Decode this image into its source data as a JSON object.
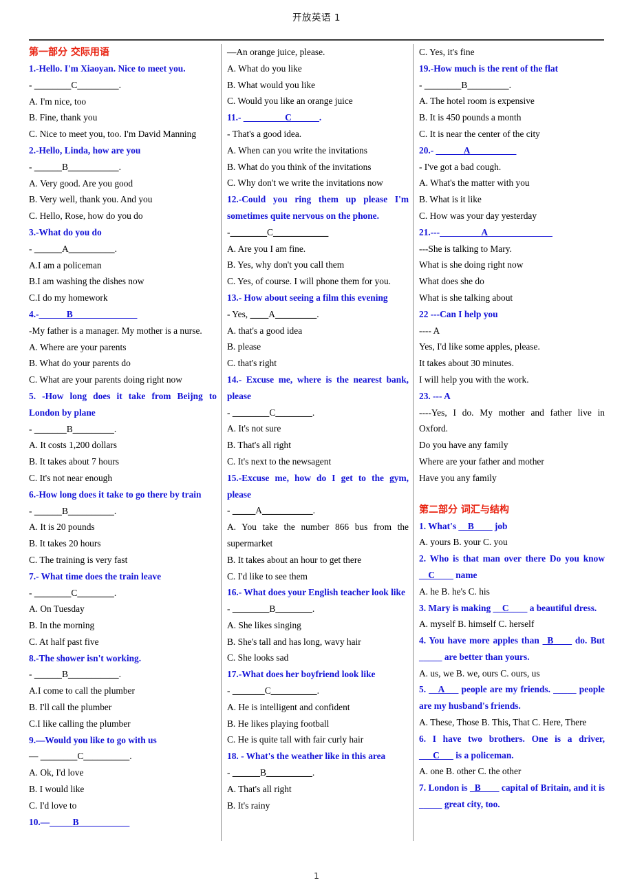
{
  "document": {
    "running_head": "开放英语 1",
    "page_number": "1"
  },
  "sections": {
    "part1_title": "第一部分  交际用语",
    "part2_title": "第二部分  词汇与结构"
  },
  "col1": [
    {
      "kind": "section",
      "text": "第一部分  交际用语"
    },
    {
      "kind": "q",
      "text": "1.-Hello. I'm Xiaoyan. Nice to meet you."
    },
    {
      "kind": "ansline",
      "prefix": "- ",
      "blank_left": "________",
      "answer": "C",
      "blank_right": "_________",
      "suffix": "."
    },
    {
      "kind": "opt",
      "text": "A. I'm nice, too"
    },
    {
      "kind": "opt",
      "text": "B. Fine, thank you"
    },
    {
      "kind": "opt",
      "text": "C. Nice to meet you, too. I'm David Manning"
    },
    {
      "kind": "q",
      "text": "2.-Hello, Linda, how are you"
    },
    {
      "kind": "ansline",
      "prefix": "- ",
      "blank_left": "______",
      "answer": "B",
      "blank_right": "___________",
      "suffix": "."
    },
    {
      "kind": "opt",
      "text": "A. Very good. Are you good"
    },
    {
      "kind": "opt",
      "text": "B. Very well, thank you. And you"
    },
    {
      "kind": "opt",
      "text": "C. Hello, Rose, how do you do"
    },
    {
      "kind": "q",
      "text": "3.-What do you do"
    },
    {
      "kind": "ansline",
      "prefix": "- ",
      "blank_left": "______",
      "answer": "A",
      "blank_right": "__________",
      "suffix": "."
    },
    {
      "kind": "opt",
      "text": "A.I am a policeman"
    },
    {
      "kind": "opt",
      "text": "B.I am washing the dishes now"
    },
    {
      "kind": "opt",
      "text": "C.I do my homework"
    },
    {
      "kind": "qblank",
      "prefix": "4.-",
      "blank_left": "______",
      "answer": "B",
      "blank_right": "______________"
    },
    {
      "kind": "opt",
      "text": "-My father is a manager. My mother is a nurse."
    },
    {
      "kind": "opt",
      "text": "A. Where are your parents"
    },
    {
      "kind": "opt",
      "text": "B. What do your parents do"
    },
    {
      "kind": "opt",
      "text": "C. What are your parents doing right now"
    },
    {
      "kind": "qjust",
      "text": "5. -How long does it take from Beijng to London by plane"
    },
    {
      "kind": "ansline",
      "prefix": "- ",
      "blank_left": "_______",
      "answer": "B",
      "blank_right": "_________",
      "suffix": "."
    },
    {
      "kind": "opt",
      "text": "A. It costs 1,200 dollars"
    },
    {
      "kind": "opt",
      "text": "B. It takes about 7 hours"
    },
    {
      "kind": "opt",
      "text": "C. It's not near enough"
    },
    {
      "kind": "q",
      "text": "6.-How long does it take to go there by train"
    },
    {
      "kind": "ansline",
      "prefix": "- ",
      "blank_left": "______",
      "answer": "B",
      "blank_right": "__________",
      "suffix": "."
    },
    {
      "kind": "opt",
      "text": "A. It is 20 pounds"
    },
    {
      "kind": "opt",
      "text": "B. It takes 20 hours"
    },
    {
      "kind": "opt",
      "text": "C. The training is very fast"
    },
    {
      "kind": "q",
      "text": "7.- What time does the train leave"
    },
    {
      "kind": "ansline",
      "prefix": "- ",
      "blank_left": "________",
      "answer": "C",
      "blank_right": "________",
      "suffix": "."
    },
    {
      "kind": "opt",
      "text": "A. On Tuesday"
    },
    {
      "kind": "opt",
      "text": "B. In the morning"
    },
    {
      "kind": "opt",
      "text": "C. At half past five"
    },
    {
      "kind": "q",
      "text": "8.-The shower isn't working."
    },
    {
      "kind": "ansline",
      "prefix": "- ",
      "blank_left": "______",
      "answer": "B",
      "blank_right": "___________",
      "suffix": "."
    },
    {
      "kind": "opt",
      "text": "A.I come to call the plumber"
    },
    {
      "kind": "opt",
      "text": "B. I'll call the plumber"
    },
    {
      "kind": "opt",
      "text": "C.I like calling the plumber"
    },
    {
      "kind": "q",
      "text": "9.—Would you like to go with us"
    },
    {
      "kind": "ansline",
      "prefix": "— ",
      "blank_left": "________",
      "answer": "C",
      "blank_right": "__________",
      "suffix": "."
    },
    {
      "kind": "opt",
      "text": "A. Ok, I'd love"
    },
    {
      "kind": "opt",
      "text": "B. I would like"
    },
    {
      "kind": "opt",
      "text": "C. I'd love to"
    },
    {
      "kind": "qblank",
      "prefix": "10.—",
      "blank_left": "_____",
      "answer": "B",
      "blank_right": "___________"
    }
  ],
  "col2": [
    {
      "kind": "opt",
      "text": "—An orange juice, please."
    },
    {
      "kind": "opt",
      "text": "A. What do you like"
    },
    {
      "kind": "opt",
      "text": "B. What would you like"
    },
    {
      "kind": "opt",
      "text": "C. Would you like an orange juice"
    },
    {
      "kind": "qblank",
      "prefix": "11.- ",
      "blank_left": "_________",
      "answer": "C",
      "blank_right": "______",
      "suffix": "."
    },
    {
      "kind": "opt",
      "text": "- That's a good idea."
    },
    {
      "kind": "opt",
      "text": "A. When can you write the invitations"
    },
    {
      "kind": "opt",
      "text": "B. What do you think of the invitations"
    },
    {
      "kind": "opt",
      "text": "C. Why don't we write the invitations now"
    },
    {
      "kind": "qjust",
      "text": "12.-Could you ring them up please I'm sometimes quite nervous on the phone."
    },
    {
      "kind": "ansline",
      "prefix": "-",
      "blank_left": "________",
      "answer": "C",
      "blank_right": "____________",
      "suffix": ""
    },
    {
      "kind": "opt",
      "text": "A. Are you I am fine."
    },
    {
      "kind": "opt",
      "text": "B. Yes, why don't you call them"
    },
    {
      "kind": "opt",
      "text": "C. Yes, of course. I will phone them for you."
    },
    {
      "kind": "q",
      "text": "13.- How about seeing a film this evening"
    },
    {
      "kind": "ansline",
      "prefix": "- Yes, ",
      "blank_left": "____",
      "answer": "A",
      "blank_right": "_________",
      "suffix": "."
    },
    {
      "kind": "opt",
      "text": "A. that's a good idea"
    },
    {
      "kind": "opt",
      "text": "B. please"
    },
    {
      "kind": "opt",
      "text": "C. that's right"
    },
    {
      "kind": "qjust",
      "text": "14.- Excuse me, where is the nearest bank, please"
    },
    {
      "kind": "ansline",
      "prefix": "- ",
      "blank_left": "________",
      "answer": "C",
      "blank_right": "________",
      "suffix": "."
    },
    {
      "kind": "opt",
      "text": "A. It's not sure"
    },
    {
      "kind": "opt",
      "text": "B. That's all right"
    },
    {
      "kind": "opt",
      "text": "C. It's next to the newsagent"
    },
    {
      "kind": "qjust",
      "text": "15.-Excuse me, how do I get to the gym, please"
    },
    {
      "kind": "ansline",
      "prefix": "- ",
      "blank_left": "_____",
      "answer": "A",
      "blank_right": "___________",
      "suffix": "."
    },
    {
      "kind": "optjust",
      "text": "A. You take the number 866 bus from the supermarket"
    },
    {
      "kind": "opt",
      "text": "B. It takes about an hour to get there"
    },
    {
      "kind": "opt",
      "text": "C. I'd like to see them"
    },
    {
      "kind": "qjust",
      "text": "16.- What does your English teacher look like"
    },
    {
      "kind": "ansline",
      "prefix": "- ",
      "blank_left": "________",
      "answer": "B",
      "blank_right": "________",
      "suffix": "."
    },
    {
      "kind": "opt",
      "text": "A. She likes singing"
    },
    {
      "kind": "opt",
      "text": "B. She's tall and has long, wavy hair"
    },
    {
      "kind": "opt",
      "text": "C. She looks sad"
    },
    {
      "kind": "q",
      "text": "17.-What does her boyfriend look like"
    },
    {
      "kind": "ansline",
      "prefix": "- ",
      "blank_left": "_______",
      "answer": "C",
      "blank_right": "__________",
      "suffix": "."
    },
    {
      "kind": "opt",
      "text": "A. He is intelligent and confident"
    },
    {
      "kind": "opt",
      "text": "B. He likes playing football"
    },
    {
      "kind": "opt",
      "text": "C. He is quite tall with fair curly hair"
    },
    {
      "kind": "q",
      "text": "18. - What's the weather like in this area"
    },
    {
      "kind": "ansline",
      "prefix": "- ",
      "blank_left": "______",
      "answer": "B",
      "blank_right": "__________",
      "suffix": "."
    },
    {
      "kind": "opt",
      "text": "A. That's all right"
    },
    {
      "kind": "opt",
      "text": "B. It's rainy"
    }
  ],
  "col3": [
    {
      "kind": "opt",
      "text": "C. Yes, it's fine"
    },
    {
      "kind": "q",
      "text": "19.-How much is the rent of the flat"
    },
    {
      "kind": "ansline",
      "prefix": "- ",
      "blank_left": "________",
      "answer": "B",
      "blank_right": "_________",
      "suffix": "."
    },
    {
      "kind": "opt",
      "text": "A. The hotel room is expensive"
    },
    {
      "kind": "opt",
      "text": "B. It is 450 pounds a month"
    },
    {
      "kind": "opt",
      "text": "C. It is near the center of the city"
    },
    {
      "kind": "qblank",
      "prefix": "20.- ",
      "blank_left": "______",
      "answer": "A",
      "blank_right": "__________"
    },
    {
      "kind": "opt",
      "text": "- I've got a bad cough."
    },
    {
      "kind": "opt",
      "text": "A. What's the matter with you"
    },
    {
      "kind": "opt",
      "text": "B. What is it like"
    },
    {
      "kind": "opt",
      "text": "C. How was your day yesterday"
    },
    {
      "kind": "qblank",
      "prefix": "21.---",
      "blank_left": "_________",
      "answer": "A",
      "blank_right": "______________"
    },
    {
      "kind": "opt",
      "text": "---She is talking to Mary."
    },
    {
      "kind": "opt",
      "text": "What is she doing right now"
    },
    {
      "kind": "opt",
      "text": "What does she do"
    },
    {
      "kind": "opt",
      "text": "What is she talking about"
    },
    {
      "kind": "q",
      "text": "22 ---Can I help you"
    },
    {
      "kind": "opt",
      "text": "---- A"
    },
    {
      "kind": "opt",
      "text": "Yes, I'd like some apples, please."
    },
    {
      "kind": "opt",
      "text": "It takes about 30 minutes."
    },
    {
      "kind": "opt",
      "text": "I will help you with the work."
    },
    {
      "kind": "q",
      "text": "23. --- A"
    },
    {
      "kind": "optjust",
      "text": "----Yes, I do. My mother and father live in Oxford."
    },
    {
      "kind": "opt",
      "text": "Do you have any family"
    },
    {
      "kind": "opt",
      "text": "Where are your father and mother"
    },
    {
      "kind": "opt",
      "text": "Have you any family"
    },
    {
      "kind": "spacer"
    },
    {
      "kind": "section",
      "text": "第二部分  词汇与结构"
    },
    {
      "kind": "qfill",
      "pre": "1. What's ",
      "blank_left": "__",
      "answer": "B",
      "blank_right": "____",
      "post": " job"
    },
    {
      "kind": "opt",
      "text": "A. yours B. your C. you"
    },
    {
      "kind": "qjustfill",
      "pre": "2. Who is that man over there Do you know ",
      "blank_left": "__",
      "answer": "C",
      "blank_right": "____",
      "post": " name"
    },
    {
      "kind": "opt",
      "text": "A. he B. he's C. his"
    },
    {
      "kind": "qjustfill",
      "pre": "3. Mary is making ",
      "blank_left": "__",
      "answer": "C",
      "blank_right": "____",
      "post": " a beautiful dress."
    },
    {
      "kind": "opt",
      "text": "A. myself B. himself C. herself"
    },
    {
      "kind": "qjustfill",
      "pre": "4. You have more apples than ",
      "blank_left": "_",
      "answer": "B",
      "blank_right": "____",
      "post": " do. But _____ are better than yours."
    },
    {
      "kind": "opt",
      "text": "A. us, we B. we, ours C. ours, us"
    },
    {
      "kind": "qjustfill",
      "pre": "5. ",
      "blank_left": "__",
      "answer": "A",
      "blank_right": "___",
      "post": " people are my friends. _____ people are my husband's friends."
    },
    {
      "kind": "opt",
      "text": "A. These, Those B. This, That C. Here, There"
    },
    {
      "kind": "qjustfill",
      "pre": "6. I have two brothers. One is a driver, ",
      "blank_left": "___",
      "answer": "C",
      "blank_right": "___",
      "post": " is a policeman."
    },
    {
      "kind": "opt",
      "text": "A. one B. other C. the other"
    },
    {
      "kind": "qjustfill",
      "pre": "7. London is ",
      "blank_left": "_",
      "answer": "B",
      "blank_right": "____",
      "post": " capital of Britain, and it is _____ great city, too."
    }
  ]
}
